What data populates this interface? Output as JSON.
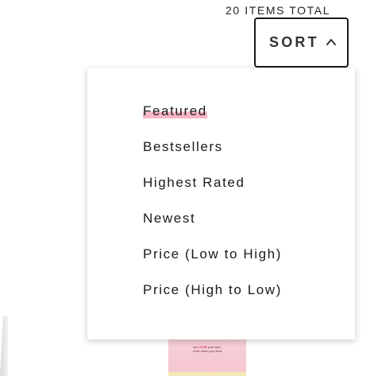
{
  "header": {
    "items_total": "20 ITEMS TOTAL"
  },
  "sort": {
    "label": "SORT",
    "expanded": true,
    "icon": "chevron-up-icon",
    "options": [
      {
        "label": "Featured",
        "selected": true
      },
      {
        "label": "Bestsellers",
        "selected": false
      },
      {
        "label": "Highest Rated",
        "selected": false
      },
      {
        "label": "Newest",
        "selected": false
      },
      {
        "label": "Price (Low to High)",
        "selected": false
      },
      {
        "label": "Price (High to Low)",
        "selected": false
      }
    ]
  },
  "product": {
    "tagline_1": "we LOVE your skin,",
    "tagline_2": "even when you dont"
  },
  "colors": {
    "selected_highlight": "#f7b6c3",
    "border": "#1a1a1a"
  }
}
